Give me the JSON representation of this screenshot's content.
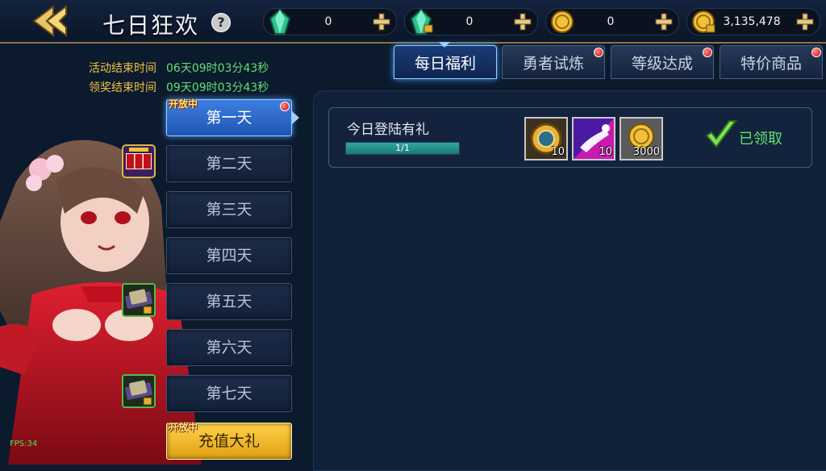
{
  "header": {
    "title": "七日狂欢",
    "help": "?",
    "resources": [
      {
        "icon": "green-gem-icon",
        "value": "0"
      },
      {
        "icon": "locked-gem-icon",
        "value": "0"
      },
      {
        "icon": "gold-coin-icon",
        "value": "0"
      },
      {
        "icon": "locked-coin-icon",
        "value": "3,135,478"
      }
    ]
  },
  "timers": {
    "event_end_label": "活动结束时间",
    "event_end_value": "06天09时03分43秒",
    "claim_end_label": "领奖结束时间",
    "claim_end_value": "09天09时03分43秒"
  },
  "days": [
    {
      "label": "第一天",
      "tag": "开放中",
      "state": "active",
      "badge": "red-dot"
    },
    {
      "label": "第二天",
      "icon": "slot-machine-icon"
    },
    {
      "label": "第三天"
    },
    {
      "label": "第四天"
    },
    {
      "label": "第五天",
      "icon": "locked-ticket-icon"
    },
    {
      "label": "第六天"
    },
    {
      "label": "第七天",
      "icon": "locked-ticket-icon"
    },
    {
      "label": "充值大礼",
      "tag": "开放中",
      "state": "gold"
    }
  ],
  "tabs": [
    {
      "label": "每日福利",
      "active": true
    },
    {
      "label": "勇者试炼",
      "badge": "red-dot"
    },
    {
      "label": "等级达成",
      "badge": "red-dot"
    },
    {
      "label": "特价商品",
      "badge": "red-dot"
    }
  ],
  "reward": {
    "title": "今日登陆有礼",
    "progress_text": "1/1",
    "progress": 1.0,
    "items": [
      {
        "icon": "gold-token-icon",
        "qty": "10"
      },
      {
        "icon": "glove-skill-icon",
        "qty": "10"
      },
      {
        "icon": "gold-coin-icon",
        "qty": "3000"
      }
    ],
    "status": "已领取"
  },
  "fps": "FPS:34"
}
